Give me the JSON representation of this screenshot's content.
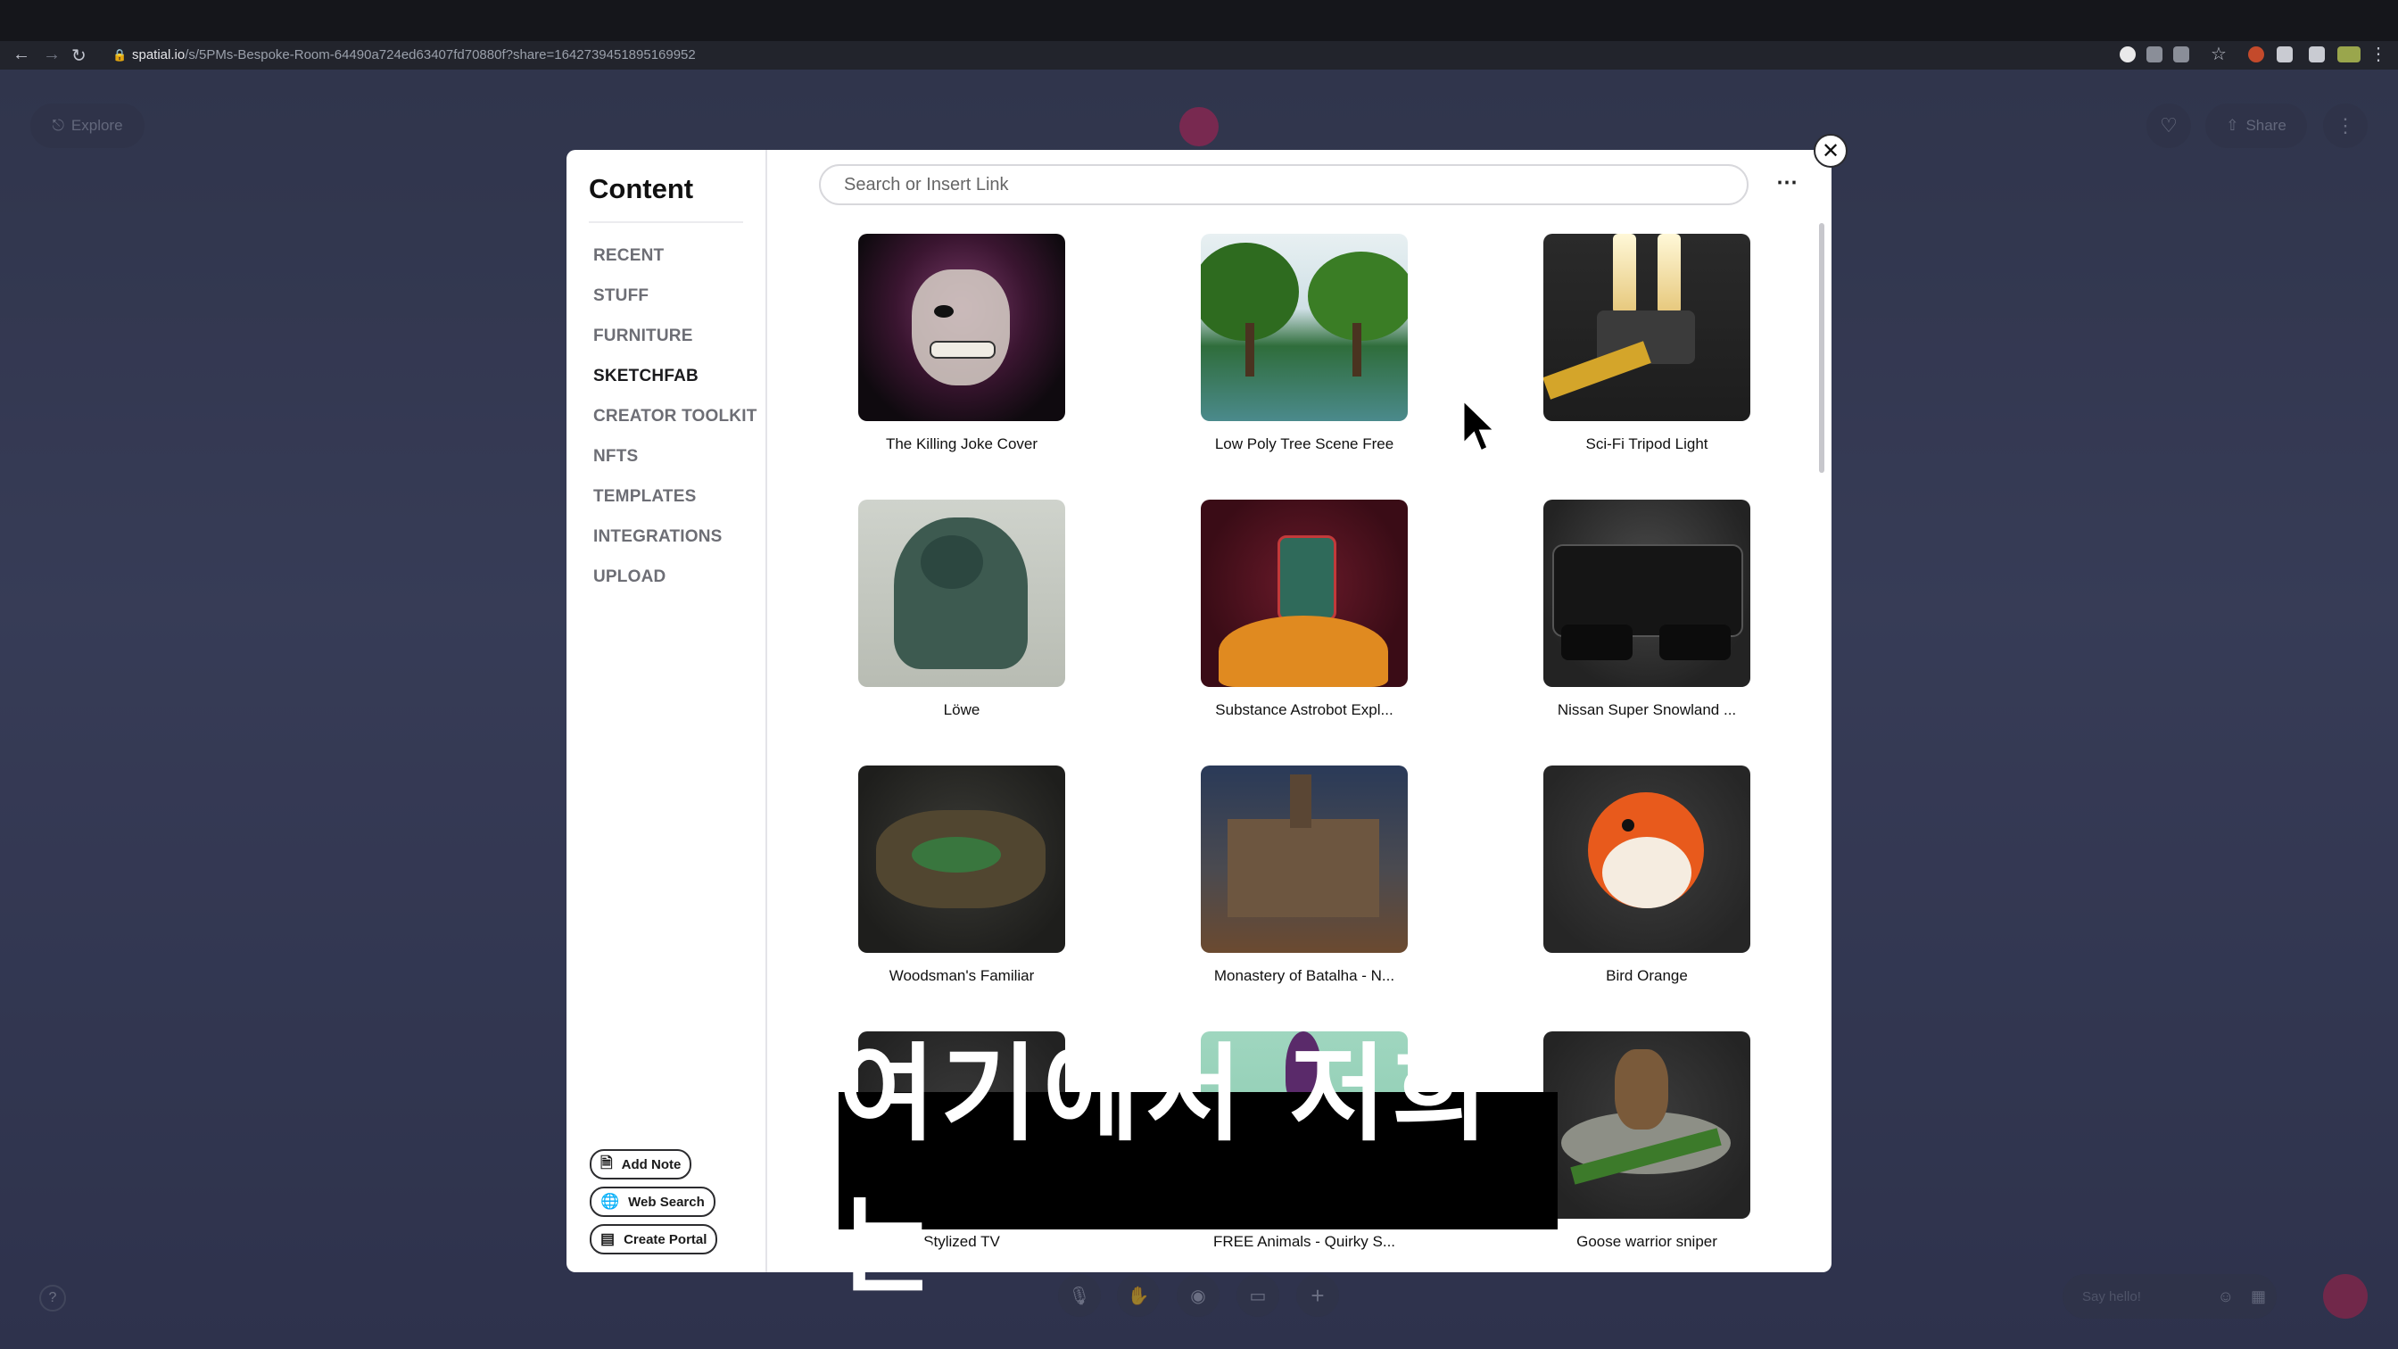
{
  "browser": {
    "url_host": "spatial.io",
    "url_path": "/s/5PMs-Bespoke-Room-64490a724ed63407fd70880f?share=1642739451895169952"
  },
  "scene": {
    "explore_label": "Explore",
    "share_label": "Share",
    "chat_placeholder": "Say hello!"
  },
  "modal": {
    "title": "Content",
    "search_placeholder": "Search or Insert Link",
    "categories": [
      "RECENT",
      "STUFF",
      "FURNITURE",
      "SKETCHFAB",
      "CREATOR TOOLKIT",
      "NFTS",
      "TEMPLATES",
      "INTEGRATIONS",
      "UPLOAD"
    ],
    "active_category": "SKETCHFAB",
    "actions": [
      {
        "label": "Add Note",
        "icon": "note-icon"
      },
      {
        "label": "Web Search",
        "icon": "globe-icon"
      },
      {
        "label": "Create Portal",
        "icon": "portal-icon"
      }
    ],
    "items": [
      {
        "label": "The Killing Joke Cover"
      },
      {
        "label": "Low Poly Tree Scene Free"
      },
      {
        "label": "Sci-Fi Tripod Light"
      },
      {
        "label": "Löwe"
      },
      {
        "label": "Substance Astrobot Expl..."
      },
      {
        "label": "Nissan Super Snowland ..."
      },
      {
        "label": "Woodsman's Familiar"
      },
      {
        "label": "Monastery of Batalha - N..."
      },
      {
        "label": "Bird Orange"
      },
      {
        "label": "Stylized TV"
      },
      {
        "label": "FREE Animals - Quirky S..."
      },
      {
        "label": "Goose warrior sniper"
      }
    ]
  },
  "caption": "여기에서 저희는",
  "colors": {
    "accent": "#111111",
    "backdrop": "#4b5276"
  }
}
